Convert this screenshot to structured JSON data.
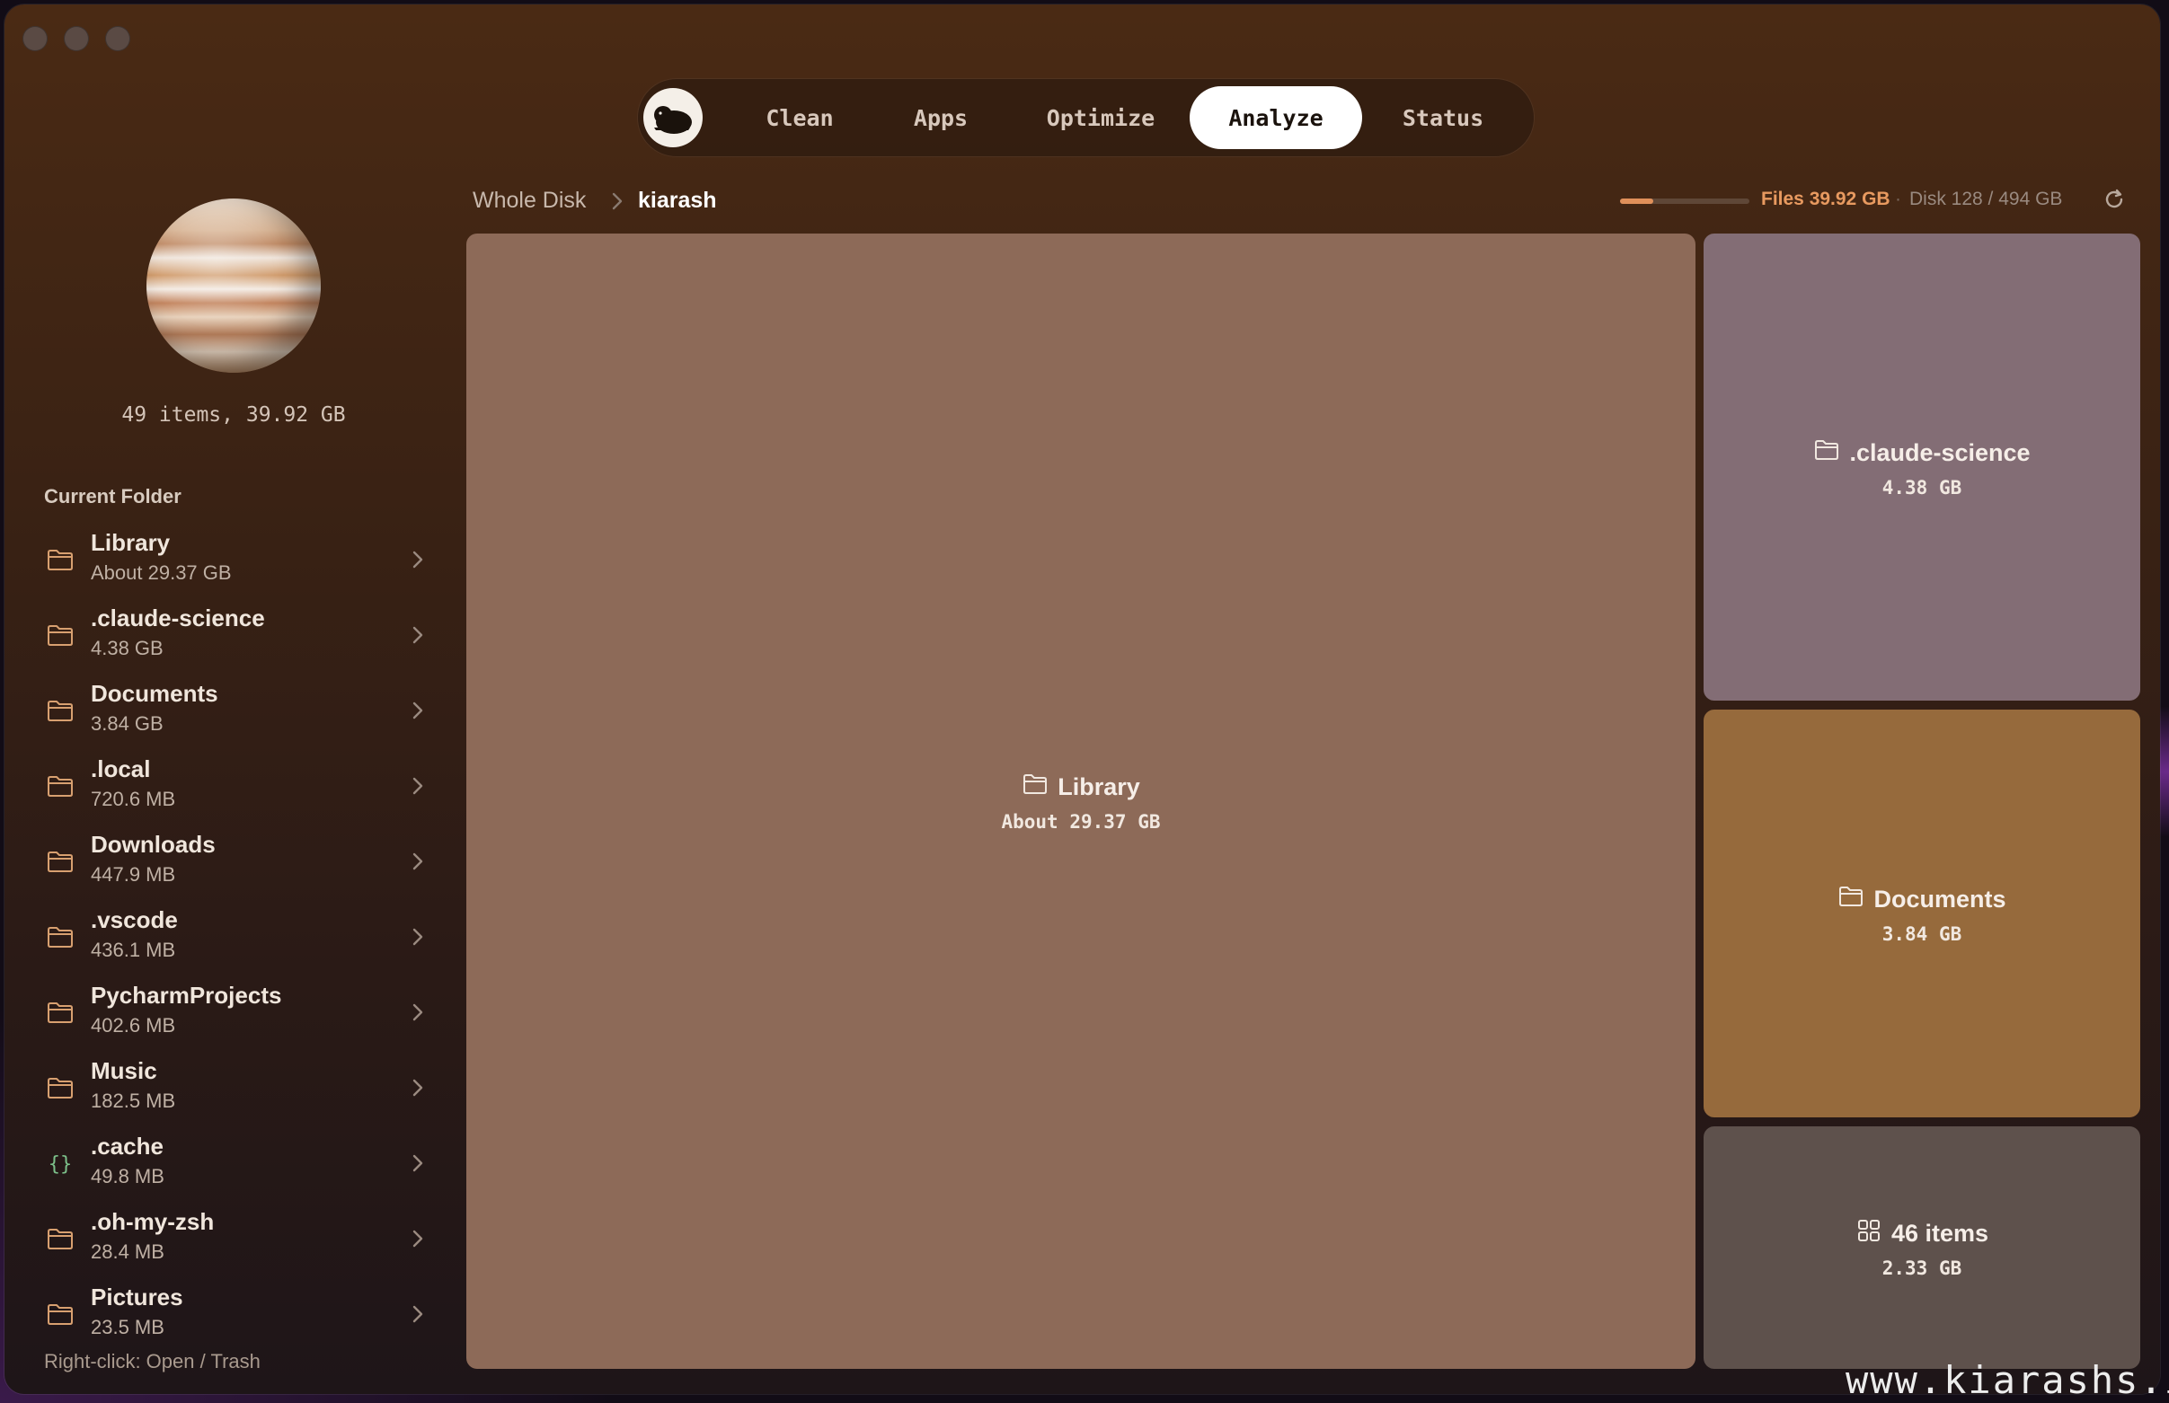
{
  "window": {
    "traffic_lights": [
      "close",
      "minimize",
      "zoom"
    ]
  },
  "tabs": [
    {
      "label": "Clean",
      "active": false
    },
    {
      "label": "Apps",
      "active": false
    },
    {
      "label": "Optimize",
      "active": false
    },
    {
      "label": "Analyze",
      "active": true
    },
    {
      "label": "Status",
      "active": false
    }
  ],
  "sidebar": {
    "summary": "49 items, 39.92 GB",
    "section_title": "Current Folder",
    "items": [
      {
        "name": "Library",
        "size": "About 29.37 GB",
        "icon": "folder-icon"
      },
      {
        "name": ".claude-science",
        "size": "4.38 GB",
        "icon": "folder-icon"
      },
      {
        "name": "Documents",
        "size": "3.84 GB",
        "icon": "folder-icon"
      },
      {
        "name": ".local",
        "size": "720.6 MB",
        "icon": "folder-icon"
      },
      {
        "name": "Downloads",
        "size": "447.9 MB",
        "icon": "folder-icon"
      },
      {
        "name": ".vscode",
        "size": "436.1 MB",
        "icon": "folder-icon"
      },
      {
        "name": "PycharmProjects",
        "size": "402.6 MB",
        "icon": "folder-icon"
      },
      {
        "name": "Music",
        "size": "182.5 MB",
        "icon": "folder-icon"
      },
      {
        "name": ".cache",
        "size": "49.8 MB",
        "icon": "braces-icon"
      },
      {
        "name": ".oh-my-zsh",
        "size": "28.4 MB",
        "icon": "folder-icon"
      },
      {
        "name": "Pictures",
        "size": "23.5 MB",
        "icon": "folder-icon"
      }
    ],
    "hint": "Right-click: Open / Trash"
  },
  "breadcrumb": {
    "root": "Whole Disk",
    "current": "kiarash"
  },
  "usage": {
    "files": "Files 39.92 GB",
    "separator": "·",
    "disk": "Disk 128 / 494 GB",
    "fill_fraction": 0.26,
    "fill_color": "#e0905a"
  },
  "treemap": [
    {
      "name": "Library",
      "size": "About 29.37 GB",
      "icon": "folder-icon",
      "color": "#8d6a58"
    },
    {
      "name": ".claude-science",
      "size": "4.38 GB",
      "icon": "folder-icon",
      "color": "#836d75"
    },
    {
      "name": "Documents",
      "size": "3.84 GB",
      "icon": "folder-icon",
      "color": "#966a3c"
    },
    {
      "name": "46 items",
      "size": "2.33 GB",
      "icon": "grid-icon",
      "color": "#5e514c"
    }
  ],
  "watermark": "www.kiarashs.ir",
  "colors": {
    "accent": "#e89a60",
    "folder_icon": "#d8a070",
    "braces_icon": "#7cc08a"
  }
}
